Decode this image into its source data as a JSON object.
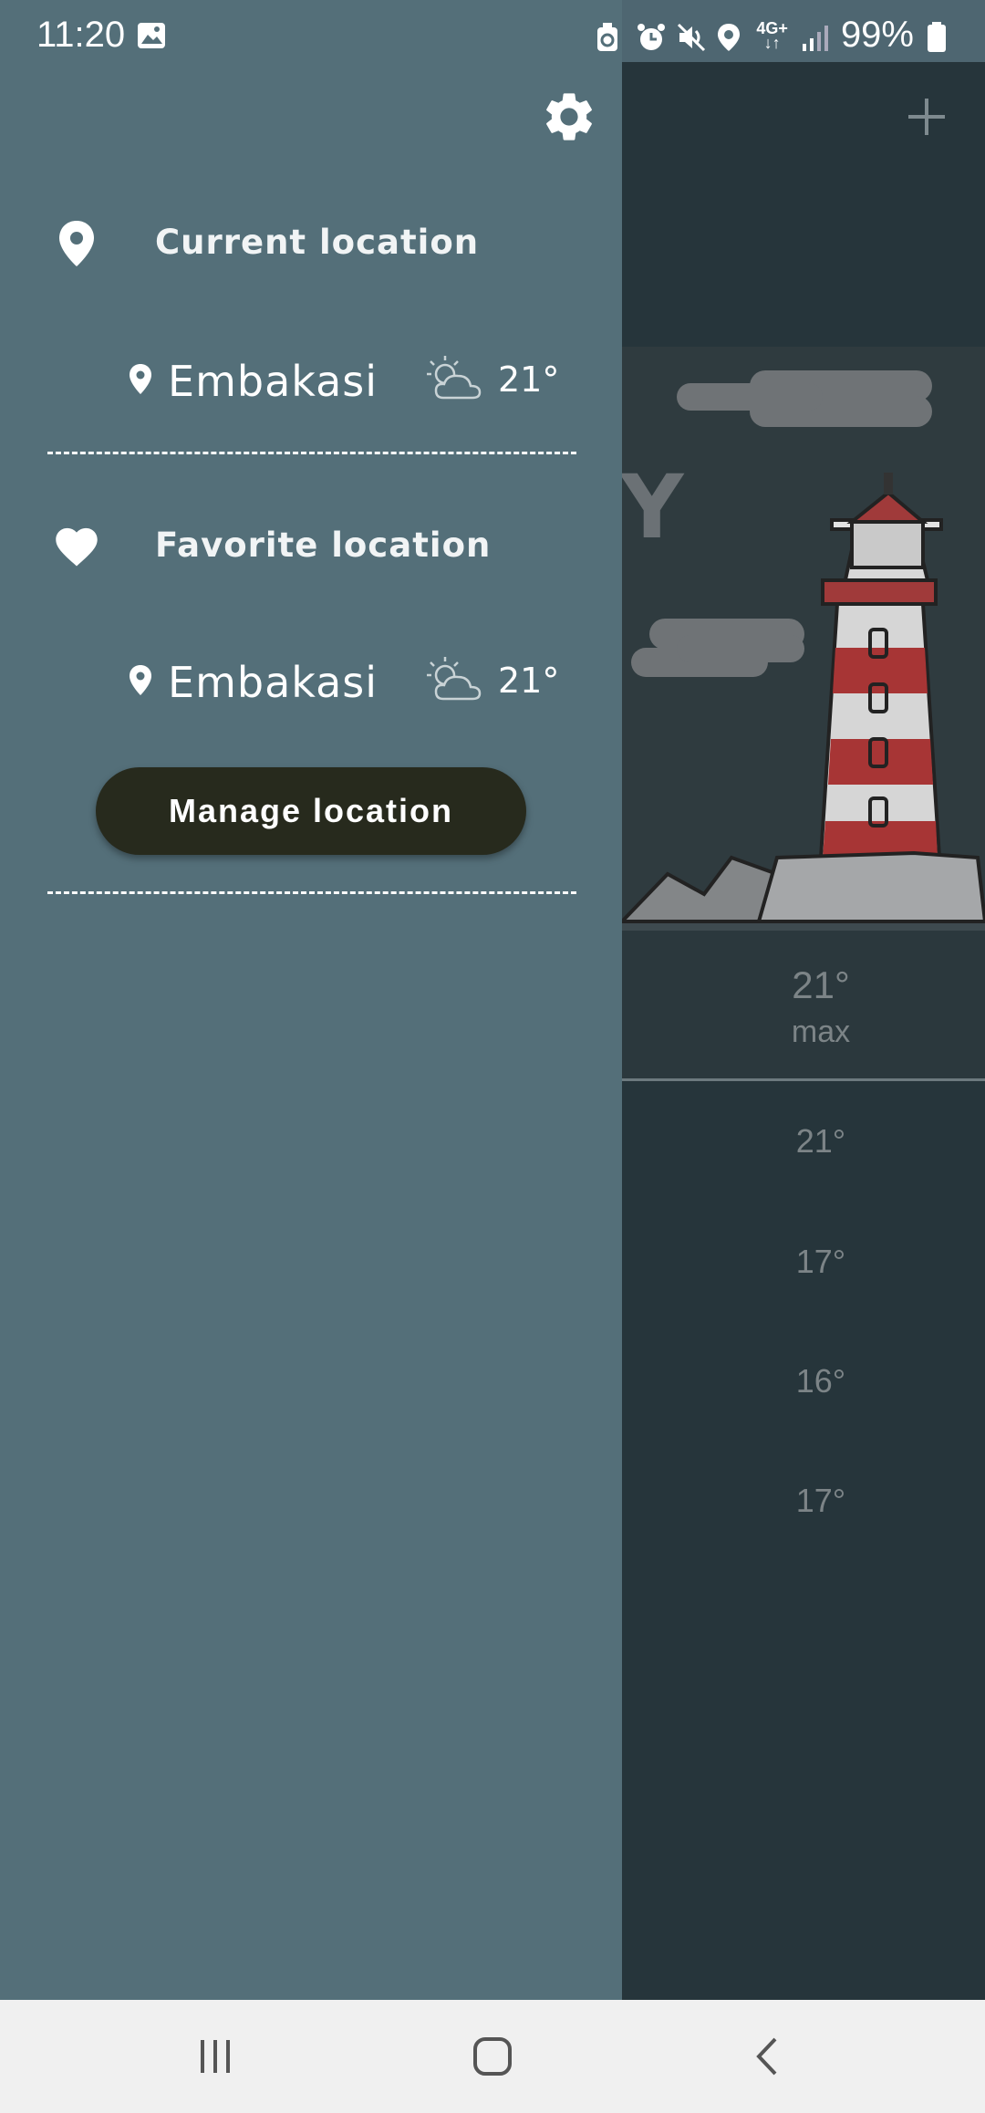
{
  "status_bar": {
    "time": "11:20",
    "battery": "99%",
    "network": "4G+",
    "icons": [
      "gallery-icon",
      "recycle-icon",
      "alarm-icon",
      "mute-icon",
      "location-icon",
      "network-icon",
      "signal-icon",
      "battery-icon"
    ]
  },
  "background_app": {
    "add_icon": "plus-icon",
    "partial_title_letter": "Y",
    "max_temp": "21°",
    "max_label": "max",
    "temps": [
      "21°",
      "17°",
      "16°",
      "17°"
    ]
  },
  "drawer": {
    "settings_icon": "gear-icon",
    "current_section": {
      "icon": "map-pin-icon",
      "title": "Current location",
      "location": {
        "name": "Embakasi",
        "temp": "21°",
        "weather_icon": "partly-cloudy-icon"
      }
    },
    "favorite_section": {
      "icon": "heart-icon",
      "title": "Favorite location",
      "location": {
        "name": "Embakasi",
        "temp": "21°",
        "weather_icon": "partly-cloudy-icon"
      }
    },
    "manage_button": "Manage location"
  },
  "nav_bar": {
    "buttons": [
      "recent-apps-icon",
      "home-icon",
      "back-icon"
    ]
  },
  "colors": {
    "drawer_bg": "#546f79",
    "button_bg": "#272a1d",
    "app_bg": "#26353b"
  }
}
